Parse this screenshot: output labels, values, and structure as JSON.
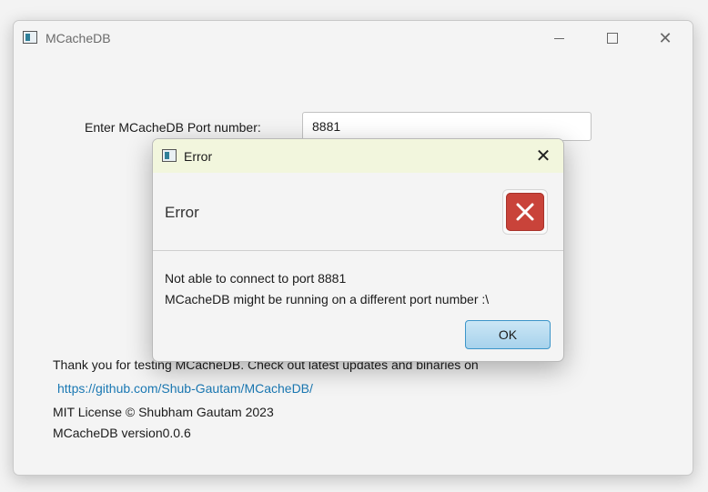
{
  "window": {
    "title": "MCacheDB",
    "controls": [
      "minimize-icon",
      "maximize-icon",
      "close-icon"
    ]
  },
  "form": {
    "port_label": "Enter MCacheDB Port number:",
    "port_value": "8881"
  },
  "footer": {
    "thanks": "Thank you for testing MCacheDB. Check out latest updates and binaries on",
    "link": "https://github.com/Shub-Gautam/MCacheDB/",
    "license": "MIT License © Shubham Gautam  2023",
    "version": "MCacheDB version0.0.6"
  },
  "dialog": {
    "title": "Error",
    "header": "Error",
    "message_line1": "Not able to connect to port 8881",
    "message_line2": "MCacheDB might be running on a different port number :\\",
    "ok_label": "OK",
    "icon": "error-x-icon"
  },
  "colors": {
    "dialog_titlebar": "#f2f6dd",
    "error_icon": "#c9433a",
    "link": "#1a78b3",
    "ok_button": "#a7d2ec"
  }
}
